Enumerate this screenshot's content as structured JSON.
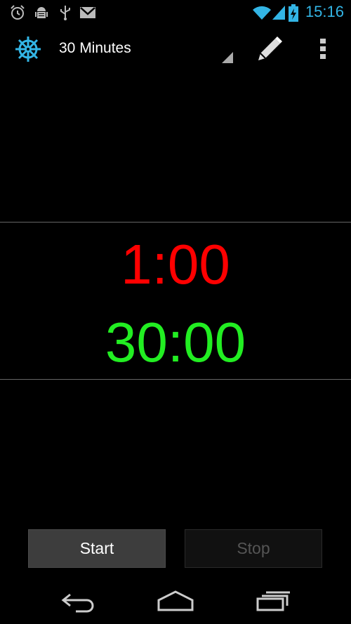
{
  "status_bar": {
    "time": "15:16",
    "icons": [
      "alarm-icon",
      "android-debug-icon",
      "usb-icon",
      "gmail-icon",
      "wifi-icon",
      "signal-icon",
      "battery-charging-icon"
    ]
  },
  "action_bar": {
    "app_icon": "ship-wheel-icon",
    "preset_label": "30 Minutes",
    "edit_icon": "pencil-icon",
    "overflow_icon": "overflow-menu-icon"
  },
  "timer": {
    "interval_time": "1:00",
    "total_time": "30:00"
  },
  "colors": {
    "accent": "#33b5e5",
    "interval": "#ff0000",
    "total": "#22ee22"
  },
  "buttons": {
    "start_label": "Start",
    "stop_label": "Stop"
  },
  "nav_bar": {
    "icons": [
      "back-icon",
      "home-icon",
      "recent-apps-icon"
    ]
  }
}
